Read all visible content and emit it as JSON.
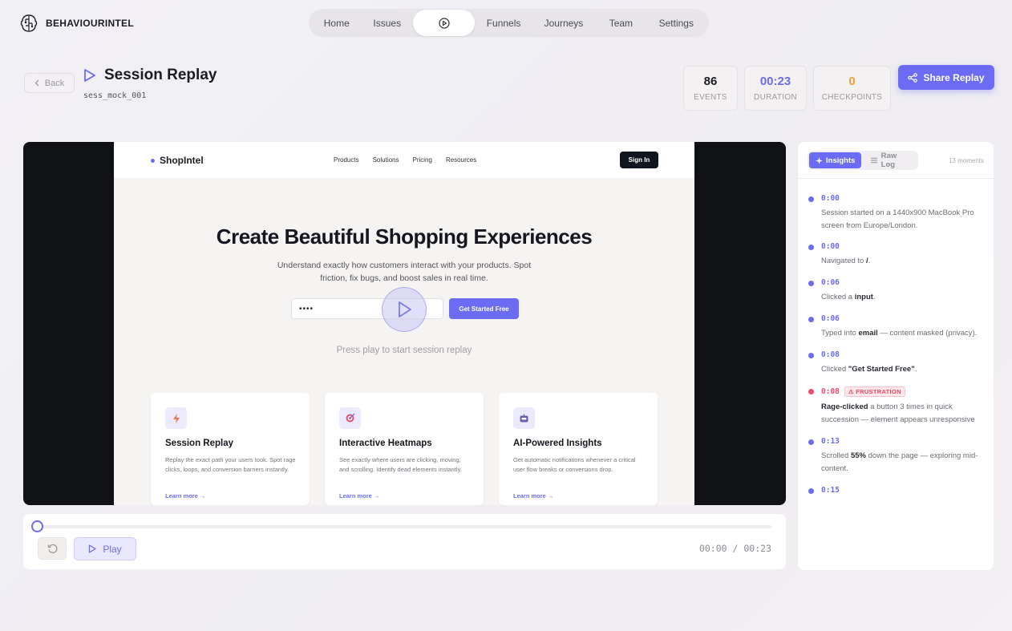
{
  "app": {
    "name": "BEHAVIOURINTEL"
  },
  "nav": {
    "items": [
      {
        "label": "Home",
        "width": 62
      },
      {
        "label": "Issues",
        "width": 65
      },
      {
        "label": "",
        "icon": "play-circle-icon",
        "active": true,
        "width": 78
      },
      {
        "label": "Funnels",
        "width": 72
      },
      {
        "label": "Journeys",
        "width": 79
      },
      {
        "label": "Team",
        "width": 65
      },
      {
        "label": "Settings",
        "width": 74
      }
    ]
  },
  "header": {
    "back_label": "Back",
    "title": "Session Replay",
    "session_id": "sess_mock_001",
    "share_label": "Share Replay"
  },
  "stats": {
    "events": {
      "value": "86",
      "label": "EVENTS",
      "color": "#1b1b24"
    },
    "duration": {
      "value": "00:23",
      "label": "DURATION",
      "color": "#6b6cf3"
    },
    "checkpoints": {
      "value": "0",
      "label": "CHECKPOINTS",
      "color": "#f0a030"
    }
  },
  "replay": {
    "site": {
      "logo": "ShopIntel",
      "links": [
        "Products",
        "Solutions",
        "Pricing",
        "Resources"
      ],
      "signin": "Sign In",
      "hero_title": "Create Beautiful Shopping Experiences",
      "hero_sub": "Understand exactly how customers interact with your products. Spot friction, fix bugs, and boost sales in real time.",
      "input_value": "••••",
      "cta": "Get Started Free",
      "features": [
        {
          "icon": "lightning-icon",
          "title": "Session Replay",
          "desc": "Replay the exact path your users took. Spot rage clicks, loops, and conversion barriers instantly.",
          "link": "Learn more →"
        },
        {
          "icon": "target-icon",
          "title": "Interactive Heatmaps",
          "desc": "See exactly where users are clicking, moving, and scrolling. Identify dead elements instantly.",
          "link": "Learn more →"
        },
        {
          "icon": "robot-icon",
          "title": "AI-Powered Insights",
          "desc": "Get automatic notifications whenever a critical user flow breaks or conversions drop.",
          "link": "Learn more →"
        }
      ]
    },
    "press_play": "Press play to start session replay"
  },
  "controls": {
    "play_label": "Play",
    "current_time": "00:00",
    "separator": "/",
    "total_time": "00:23",
    "progress": 0
  },
  "insights": {
    "tab_insights": "Insights",
    "tab_rawlog": "Raw Log",
    "moments": "13 moments",
    "events": [
      {
        "time": "0:00",
        "parts": [
          [
            "t",
            "Session started on a 1440x900 MacBook Pro screen from Europe/London."
          ]
        ]
      },
      {
        "time": "0:00",
        "parts": [
          [
            "t",
            "Navigated to "
          ],
          [
            "b",
            "/"
          ],
          [
            "t",
            "."
          ]
        ]
      },
      {
        "time": "0:06",
        "parts": [
          [
            "t",
            "Clicked a "
          ],
          [
            "b",
            "input"
          ],
          [
            "t",
            "."
          ]
        ]
      },
      {
        "time": "0:06",
        "parts": [
          [
            "t",
            "Typed into "
          ],
          [
            "b",
            "email"
          ],
          [
            "t",
            " — content masked (privacy)."
          ]
        ]
      },
      {
        "time": "0:08",
        "parts": [
          [
            "t",
            "Clicked "
          ],
          [
            "b",
            "\"Get Started Free\""
          ],
          [
            "t",
            "."
          ]
        ]
      },
      {
        "time": "0:08",
        "badge": "⚠ FRUSTRATION",
        "frustration": true,
        "parts": [
          [
            "b",
            "Rage-clicked"
          ],
          [
            "t",
            " a button 3 times in quick succession — element appears unresponsive"
          ]
        ]
      },
      {
        "time": "0:13",
        "parts": [
          [
            "t",
            "Scrolled "
          ],
          [
            "b",
            "55%"
          ],
          [
            "t",
            " down the page — exploring mid-content."
          ]
        ]
      },
      {
        "time": "0:15",
        "parts": []
      }
    ]
  },
  "colors": {
    "accent": "#6b6cf3",
    "frustration": "#f04b6a",
    "warning": "#f0a030"
  }
}
